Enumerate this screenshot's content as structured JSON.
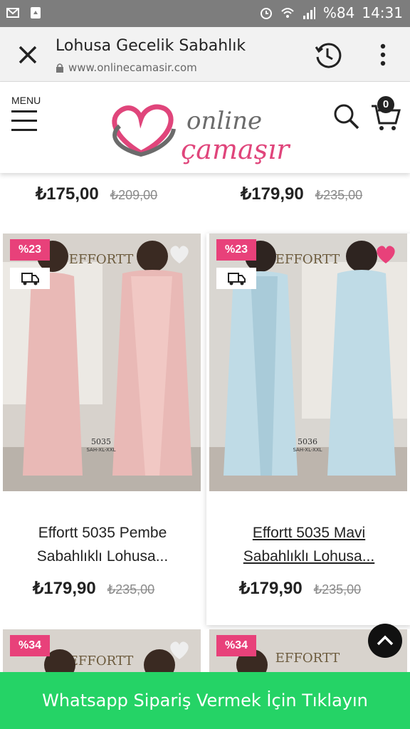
{
  "status": {
    "battery": "%84",
    "time": "14:31",
    "left_icons": [
      "mail-icon",
      "recycle-icon"
    ],
    "right_icons": [
      "alarm-icon",
      "wifi-icon",
      "signal-icon"
    ]
  },
  "browser": {
    "title": "Lohusa Gecelik Sabahlık",
    "url": "www.onlinecamasir.com",
    "icons": [
      "close-icon",
      "lock-icon",
      "history-icon",
      "kebab-menu-icon"
    ]
  },
  "site": {
    "menu_label": "MENU",
    "logo_line1": "online",
    "logo_line2": "çamaşır",
    "cart_count": "0",
    "colors": {
      "brand_pink": "#e0457b",
      "logo_gray": "#6b6b6b"
    }
  },
  "top_prices": [
    {
      "price": "₺175,00",
      "old_price": "₺209,00"
    },
    {
      "price": "₺179,90",
      "old_price": "₺235,00"
    }
  ],
  "products": [
    {
      "badge": "%23",
      "brand_mark": "EFFORTT",
      "code": "5035",
      "sizes": "SAH-XL-XXL",
      "name_line1": "Effortt 5035 Pembe",
      "name_line2": "Sabahlıklı Lohusa...",
      "price": "₺179,90",
      "old_price": "₺235,00",
      "favorited": false,
      "garment_color": "#e9b9b6"
    },
    {
      "badge": "%23",
      "brand_mark": "EFFORTT",
      "code": "5036",
      "sizes": "SAH-XL-XXL",
      "name_line1": "Effortt 5035 Mavi",
      "name_line2": "Sabahlıklı Lohusa...",
      "price": "₺179,90",
      "old_price": "₺235,00",
      "favorited": true,
      "garment_color": "#bfdbe6"
    },
    {
      "badge": "%34",
      "brand_mark": "EFFORTT"
    },
    {
      "badge": "%34",
      "brand_mark": "EFFORTT"
    }
  ],
  "whatsapp": {
    "label": " Whatsapp Sipariş Vermek İçin Tıklayın"
  },
  "colors": {
    "whatsapp_green": "#25d366",
    "badge_pink": "#e8417a",
    "heart_red": "#e8417a"
  }
}
